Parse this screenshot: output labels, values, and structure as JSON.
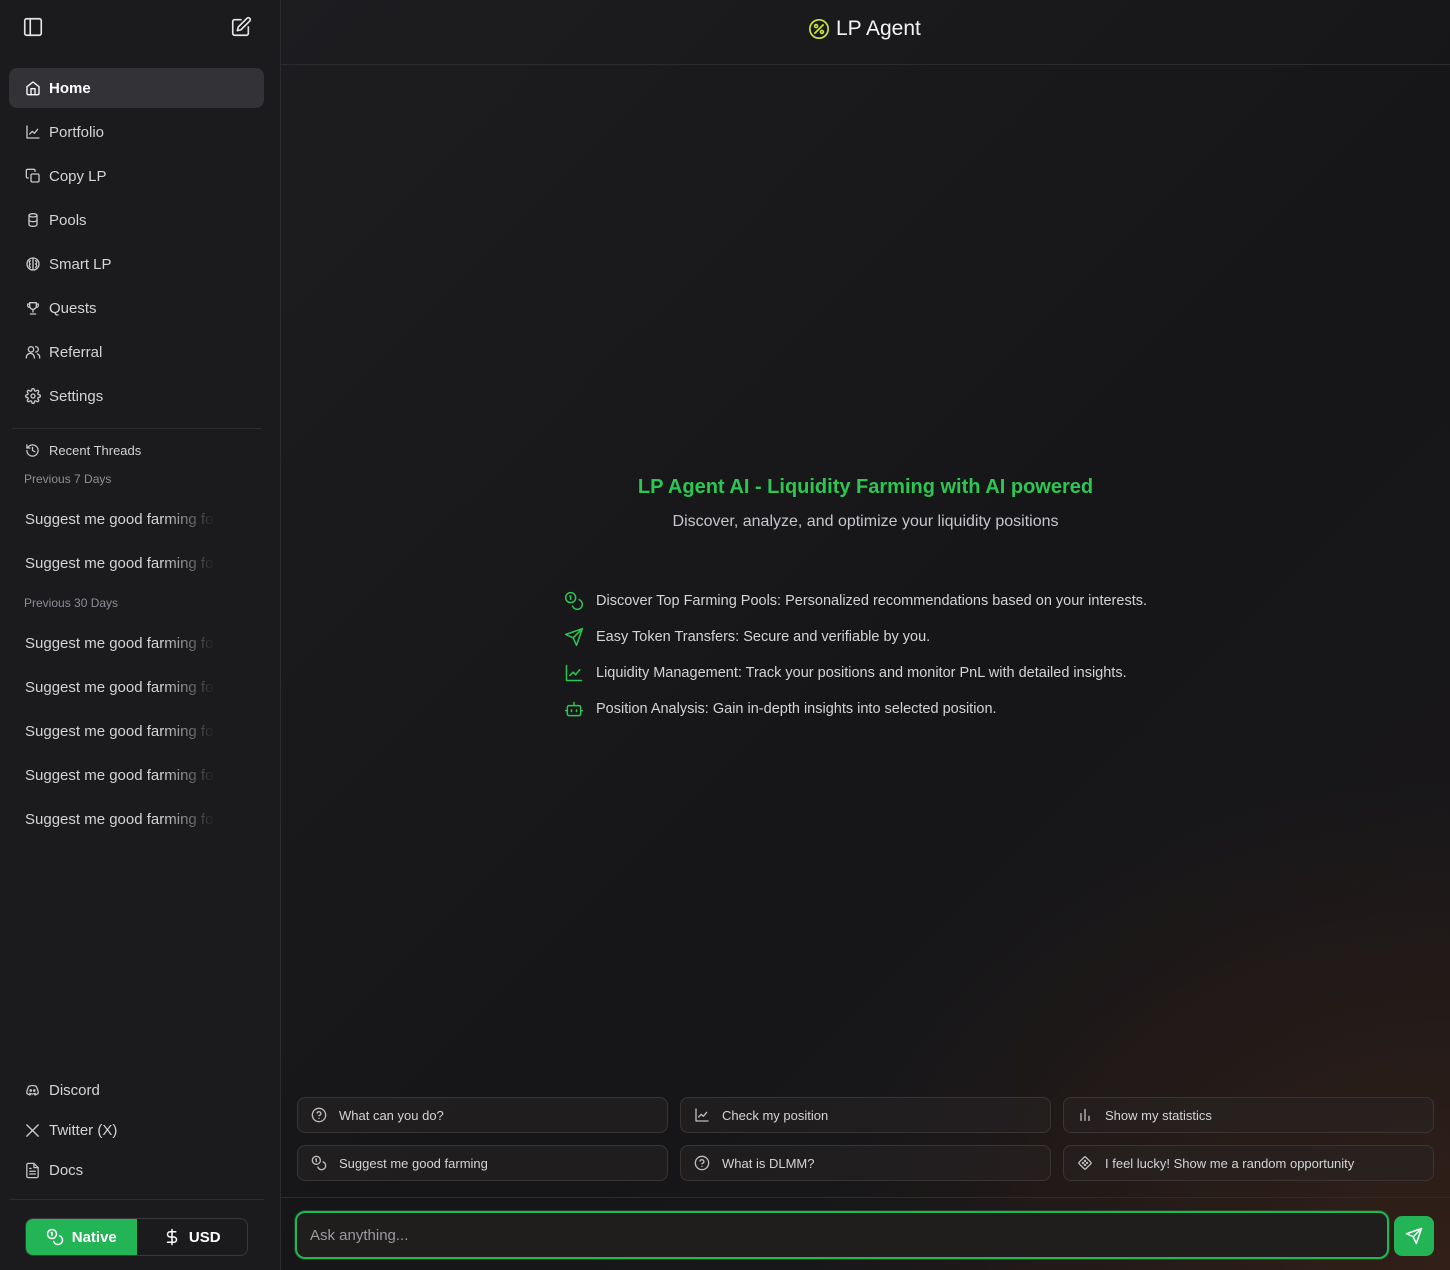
{
  "sidebar": {
    "toggle_icon": "sidebar-toggle-icon",
    "new_chat_icon": "edit-icon",
    "nav": [
      {
        "label": "Home",
        "icon": "home-icon",
        "active": true
      },
      {
        "label": "Portfolio",
        "icon": "chart-line-icon"
      },
      {
        "label": "Copy LP",
        "icon": "copy-icon"
      },
      {
        "label": "Pools",
        "icon": "cylinder-icon"
      },
      {
        "label": "Smart LP",
        "icon": "brain-icon"
      },
      {
        "label": "Quests",
        "icon": "trophy-icon"
      },
      {
        "label": "Referral",
        "icon": "users-icon"
      },
      {
        "label": "Settings",
        "icon": "gear-icon"
      }
    ],
    "recent_threads_label": "Recent Threads",
    "groups": [
      {
        "label": "Previous 7 Days",
        "threads": [
          "Suggest me good farming fo",
          "Suggest me good farming fo"
        ]
      },
      {
        "label": "Previous 30 Days",
        "threads": [
          "Suggest me good farming fo",
          "Suggest me good farming fo",
          "Suggest me good farming fo",
          "Suggest me good farming fo",
          "Suggest me good farming fo"
        ]
      }
    ],
    "footer_links": [
      {
        "label": "Discord",
        "icon": "discord-icon"
      },
      {
        "label": "Twitter (X)",
        "icon": "x-logo-icon"
      },
      {
        "label": "Docs",
        "icon": "document-icon"
      }
    ],
    "currency_toggle": {
      "native": "Native",
      "usd": "USD",
      "selected": "Native"
    }
  },
  "header": {
    "title": "LP Agent"
  },
  "hero": {
    "title": "LP Agent AI - Liquidity Farming with AI powered",
    "subtitle": "Discover, analyze, and optimize your liquidity positions",
    "features": [
      {
        "text": "Discover Top Farming Pools: Personalized recommendations based on your interests.",
        "icon": "coins-icon"
      },
      {
        "text": "Easy Token Transfers: Secure and verifiable by you.",
        "icon": "send-icon"
      },
      {
        "text": "Liquidity Management: Track your positions and monitor PnL with detailed insights.",
        "icon": "chart-line-icon"
      },
      {
        "text": "Position Analysis: Gain in-depth insights into selected position.",
        "icon": "bot-icon"
      }
    ]
  },
  "suggestions": [
    {
      "label": "What can you do?",
      "icon": "question-icon"
    },
    {
      "label": "Check my position",
      "icon": "chart-line-icon"
    },
    {
      "label": "Show my statistics",
      "icon": "bar-chart-icon"
    },
    {
      "label": "Suggest me good farming",
      "icon": "coins-icon"
    },
    {
      "label": "What is DLMM?",
      "icon": "question-icon"
    },
    {
      "label": "I feel lucky! Show me a random opportunity",
      "icon": "dice-icon"
    }
  ],
  "composer": {
    "placeholder": "Ask anything...",
    "value": ""
  },
  "colors": {
    "accent": "#22b455",
    "title_green": "#2dc653",
    "background": "#17171a"
  }
}
